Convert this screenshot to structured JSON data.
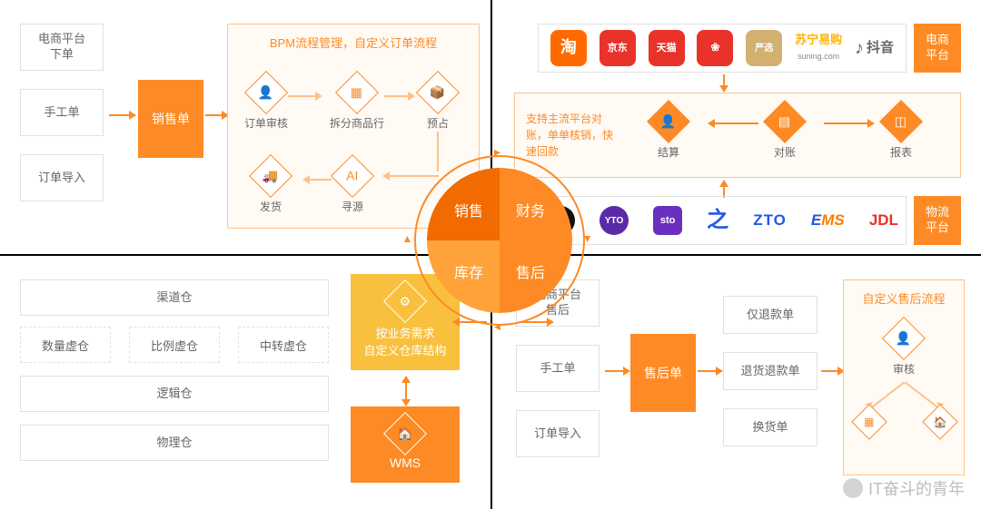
{
  "center": {
    "sales": "销售",
    "finance": "财务",
    "inventory": "库存",
    "aftersales": "售后"
  },
  "q1": {
    "inputs": [
      "电商平台\n下单",
      "手工单",
      "订单导入"
    ],
    "hub": "销售单",
    "bpm_title": "BPM流程管理，自定义订单流程",
    "steps": {
      "audit": "订单审核",
      "split": "拆分商品行",
      "reserve": "预占",
      "ship": "发货",
      "source": "寻源"
    }
  },
  "q2": {
    "side_ecom": "电商\n平台",
    "side_logi": "物流\n平台",
    "note": "支持主流平台对账，单单核销，快速回款",
    "settle": "结算",
    "recon": "对账",
    "report": "报表",
    "ecom_brands": [
      {
        "n": "淘",
        "c": "#ff6a00"
      },
      {
        "n": "京东",
        "c": "#e8322a"
      },
      {
        "n": "天猫",
        "c": "#e8322a"
      },
      {
        "n": "拼多多",
        "c": "#e8322a"
      },
      {
        "n": "严选",
        "c": "#d2b070"
      },
      {
        "n": "苏宁易购",
        "c": "#ffb400",
        "t": "suning.com"
      },
      {
        "n": "抖音",
        "c": "#111"
      }
    ],
    "logi_brands": [
      {
        "n": "SF",
        "c": "#111"
      },
      {
        "n": "YTO",
        "c": "#5a2aa8"
      },
      {
        "n": "sto",
        "c": "#6b2fbf"
      },
      {
        "n": "之",
        "c": "#2357e8"
      },
      {
        "n": "ZTO",
        "c": "#2357e8",
        "plain": true
      },
      {
        "n": "EMS",
        "c": "#ff7a00",
        "plain": true,
        "italic": true
      },
      {
        "n": "JDL",
        "c": "#e8322a",
        "plain": true
      }
    ]
  },
  "q3": {
    "note": "按业务需求\n自定义仓库结构",
    "wms": "WMS",
    "w_channel": "渠道仓",
    "w_qty": "数量虚仓",
    "w_ratio": "比例虚仓",
    "w_transit": "中转虚仓",
    "w_logic": "逻辑仓",
    "w_phys": "物理仓"
  },
  "q4": {
    "inputs": [
      "电商平台\n售后",
      "手工单",
      "订单导入"
    ],
    "hub": "售后单",
    "types": [
      "仅退款单",
      "退货退款单",
      "换货单"
    ],
    "flow_title": "自定义售后流程",
    "audit": "审核"
  },
  "watermark": "IT奋斗的青年"
}
